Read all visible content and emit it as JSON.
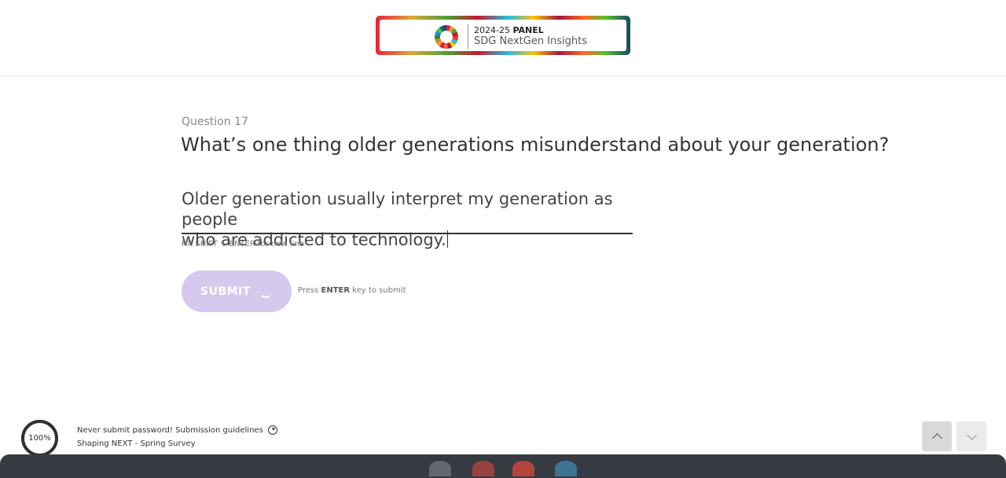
{
  "header": {
    "logo_year": "2024-25",
    "logo_panel": "PANEL",
    "logo_name": "SDG NextGen Insights"
  },
  "question": {
    "number_label": "Question 17",
    "title": "What’s one thing older generations misunderstand about your generation?",
    "answer_line1": "Older generation usually interpret my generation as people",
    "answer_line2": "who are addicted to technology.",
    "hint": "Hit SHIFT + ENTER for new line"
  },
  "submit": {
    "label": "SUBMIT",
    "press_prefix": "Press",
    "press_key": "ENTER",
    "press_suffix": "key to submit"
  },
  "footer": {
    "progress": "100%",
    "notice": "Never submit password! Submission guidelines",
    "survey_name": "Shaping NEXT - Spring Survey"
  },
  "taskbar": {
    "icons": [
      "files-icon",
      "app-red-icon",
      "chrome-icon",
      "app-blue-icon"
    ]
  }
}
